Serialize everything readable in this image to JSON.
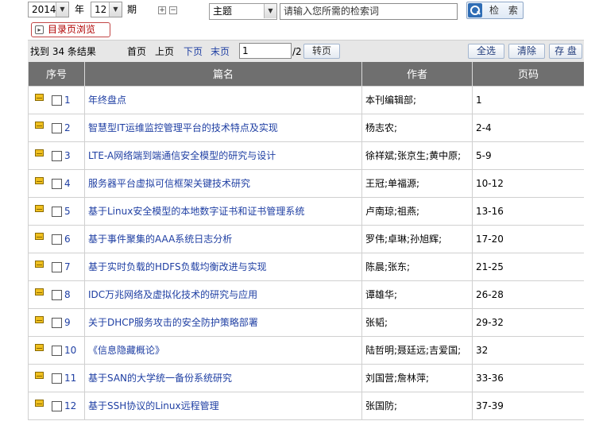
{
  "search": {
    "year": "2014",
    "year_label": "年",
    "issue": "12",
    "issue_label": "期",
    "plus": "+",
    "minus": "−",
    "field": "主题",
    "keyword_placeholder": "请输入您所需的检索词",
    "search_button": "检 索",
    "catalog_button": "目录页浏览"
  },
  "pager": {
    "result_text": "找到 34 条结果",
    "first": "首页",
    "prev": "上页",
    "next": "下页",
    "last": "末页",
    "page_value": "1",
    "total_pages": "/2",
    "goto": "转页",
    "select_all": "全选",
    "clear": "清除",
    "save": "存 盘"
  },
  "table": {
    "headers": [
      "序号",
      "篇名",
      "作者",
      "页码"
    ],
    "rows": [
      {
        "no": "1",
        "title": "年终盘点",
        "author": "本刊编辑部;",
        "pages": "1"
      },
      {
        "no": "2",
        "title": "智慧型IT运维监控管理平台的技术特点及实现",
        "author": "杨志农;",
        "pages": "2-4"
      },
      {
        "no": "3",
        "title": "LTE-A网络端到端通信安全模型的研究与设计",
        "author": "徐祥斌;张京生;黄中原;",
        "pages": "5-9"
      },
      {
        "no": "4",
        "title": "服务器平台虚拟可信框架关键技术研究",
        "author": "王冠;单福源;",
        "pages": "10-12"
      },
      {
        "no": "5",
        "title": "基于Linux安全模型的本地数字证书和证书管理系统",
        "author": "卢南琼;祖燕;",
        "pages": "13-16"
      },
      {
        "no": "6",
        "title": "基于事件聚集的AAA系统日志分析",
        "author": "罗伟;卓琳;孙旭辉;",
        "pages": "17-20"
      },
      {
        "no": "7",
        "title": "基于实时负载的HDFS负载均衡改进与实现",
        "author": "陈晨;张东;",
        "pages": "21-25"
      },
      {
        "no": "8",
        "title": "IDC万兆网络及虚拟化技术的研究与应用",
        "author": "谭雄华;",
        "pages": "26-28"
      },
      {
        "no": "9",
        "title": "关于DHCP服务攻击的安全防护策略部署",
        "author": "张韬;",
        "pages": "29-32"
      },
      {
        "no": "10",
        "title": "《信息隐藏概论》",
        "author": "陆哲明;聂廷远;吉爱国;",
        "pages": "32"
      },
      {
        "no": "11",
        "title": "基于SAN的大学统一备份系统研究",
        "author": "刘国营;詹林萍;",
        "pages": "33-36"
      },
      {
        "no": "12",
        "title": "基于SSH协议的Linux远程管理",
        "author": "张国防;",
        "pages": "37-39"
      }
    ]
  }
}
